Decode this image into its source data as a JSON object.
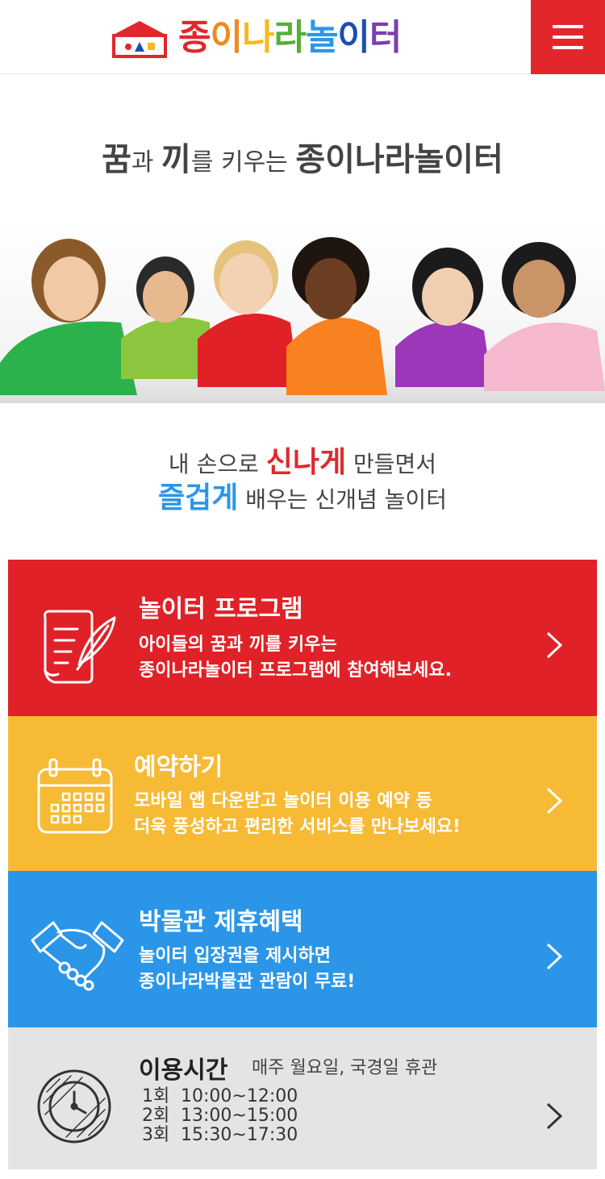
{
  "header": {
    "logo_chars": [
      {
        "ch": "종",
        "color": "#e2272c"
      },
      {
        "ch": "이",
        "color": "#f08a1e"
      },
      {
        "ch": "나",
        "color": "#f6ba1e"
      },
      {
        "ch": "라",
        "color": "#55b035"
      },
      {
        "ch": "놀",
        "color": "#2b96e8"
      },
      {
        "ch": "이",
        "color": "#1b4fb0"
      },
      {
        "ch": "터",
        "color": "#7a3fb0"
      }
    ],
    "menu_icon": "hamburger-icon"
  },
  "hero": {
    "w1": "꿈",
    "w2": "과 ",
    "w3": "끼",
    "w4": "를 키우는 ",
    "w5": "종이나라놀이터"
  },
  "slogan": {
    "l1a": "내 손으로 ",
    "l1b": "신나게",
    "l1c": " 만들면서",
    "l2a": "즐겁게",
    "l2b": " 배우는 신개념 놀이터",
    "red": "#e2272c",
    "blue": "#2b96e8"
  },
  "cards": {
    "program": {
      "title": "놀이터 프로그램",
      "desc1": "아이들의 꿈과 끼를 키우는",
      "desc2": "종이나라놀이터 프로그램에 참여해보세요.",
      "icon": "paper-quill-icon",
      "color": "#e02127"
    },
    "reserve": {
      "title": "예약하기",
      "desc1": "모바일 앱 다운받고 놀이터 이용 예약 등",
      "desc2": "더욱 풍성하고 편리한 서비스를 만나보세요!",
      "icon": "calendar-icon",
      "color": "#f6ba35"
    },
    "museum": {
      "title": "박물관 제휴혜택",
      "desc1": "놀이터 입장권을 제시하면",
      "desc2": "종이나라박물관 관람이 무료!",
      "icon": "handshake-icon",
      "color": "#2b96e8"
    },
    "hours": {
      "title": "이용시간",
      "closed": "매주 월요일, 국경일 휴관",
      "sessions": [
        {
          "n": "1회",
          "t": "10:00~12:00"
        },
        {
          "n": "2회",
          "t": "13:00~15:00"
        },
        {
          "n": "3회",
          "t": "15:30~17:30"
        }
      ],
      "icon": "clock-icon",
      "color": "#e4e4e4"
    }
  }
}
